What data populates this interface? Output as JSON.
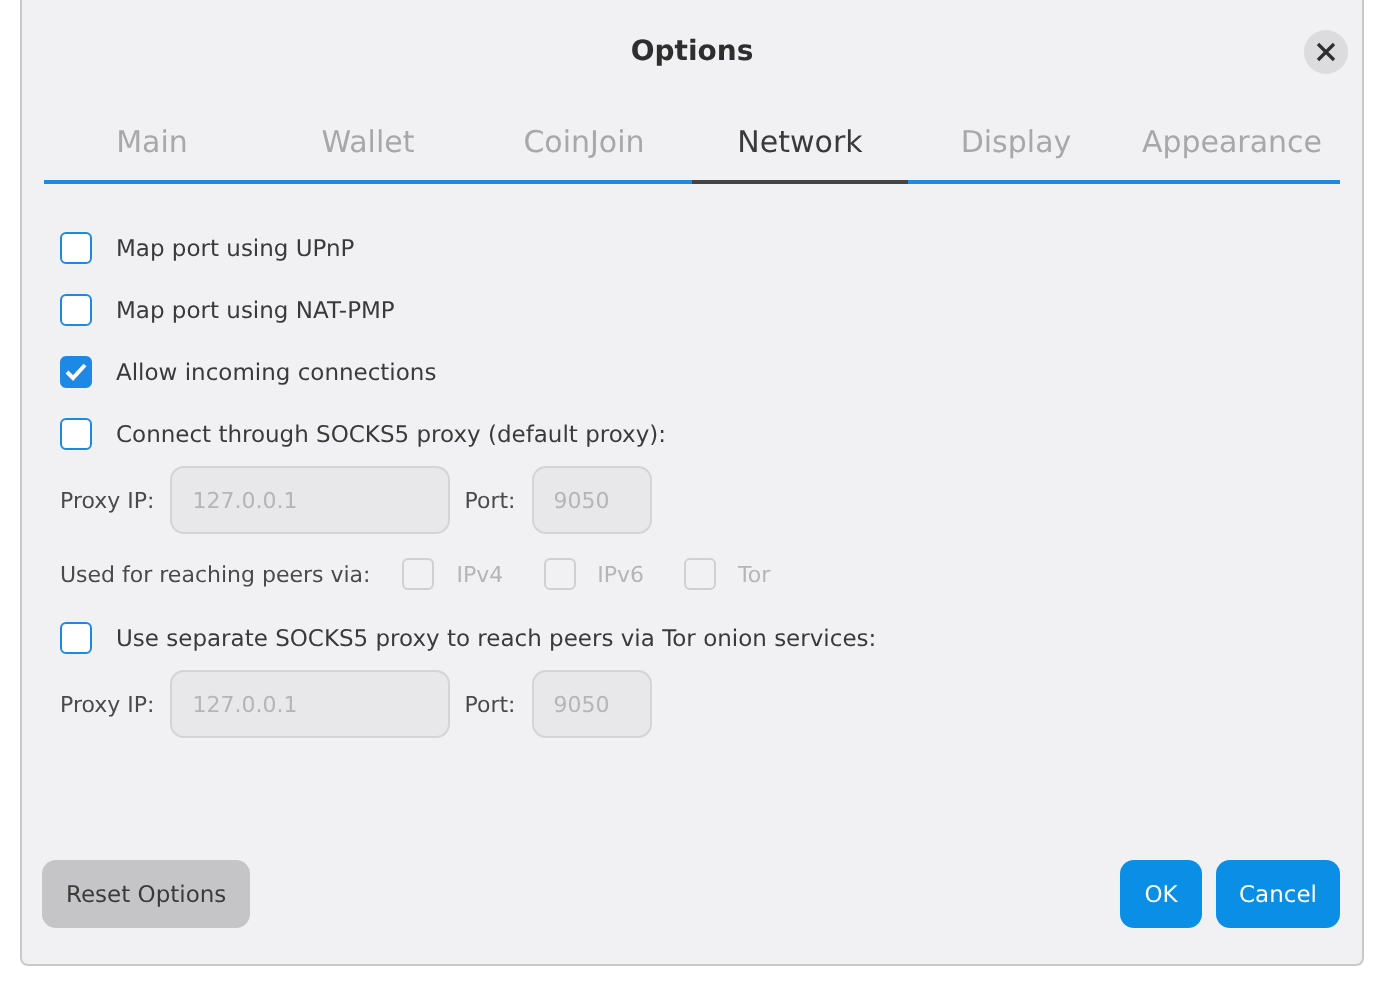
{
  "window": {
    "title": "Options"
  },
  "tabs": [
    {
      "label": "Main",
      "selected": false
    },
    {
      "label": "Wallet",
      "selected": false
    },
    {
      "label": "CoinJoin",
      "selected": false
    },
    {
      "label": "Network",
      "selected": true
    },
    {
      "label": "Display",
      "selected": false
    },
    {
      "label": "Appearance",
      "selected": false
    }
  ],
  "options": [
    {
      "kind": "checkbox",
      "label": "Map port using UPnP",
      "checked": false
    },
    {
      "kind": "checkbox",
      "label": "Map port using NAT-PMP",
      "checked": false
    },
    {
      "kind": "checkbox",
      "label": "Allow incoming connections",
      "checked": true
    },
    {
      "kind": "checkbox",
      "label": "Connect through SOCKS5 proxy (default proxy):",
      "checked": false
    },
    {
      "kind": "proxy",
      "ip_label": "Proxy IP:",
      "ip_value": "127.0.0.1",
      "port_label": "Port:",
      "port_value": "9050",
      "disabled": true
    },
    {
      "kind": "networks",
      "label": "Used for reaching peers via:",
      "items": [
        {
          "label": "IPv4",
          "checked": false,
          "disabled": true
        },
        {
          "label": "IPv6",
          "checked": false,
          "disabled": true
        },
        {
          "label": "Tor",
          "checked": false,
          "disabled": true
        }
      ]
    },
    {
      "kind": "checkbox",
      "label": "Use separate SOCKS5 proxy to reach peers via Tor onion services:",
      "checked": false
    },
    {
      "kind": "proxy",
      "ip_label": "Proxy IP:",
      "ip_value": "127.0.0.1",
      "port_label": "Port:",
      "port_value": "9050",
      "disabled": true
    }
  ],
  "buttons": [
    {
      "label": "Reset Options",
      "kind": "secondary"
    },
    {
      "label": "OK",
      "kind": "primary"
    },
    {
      "label": "Cancel",
      "kind": "primary"
    }
  ]
}
